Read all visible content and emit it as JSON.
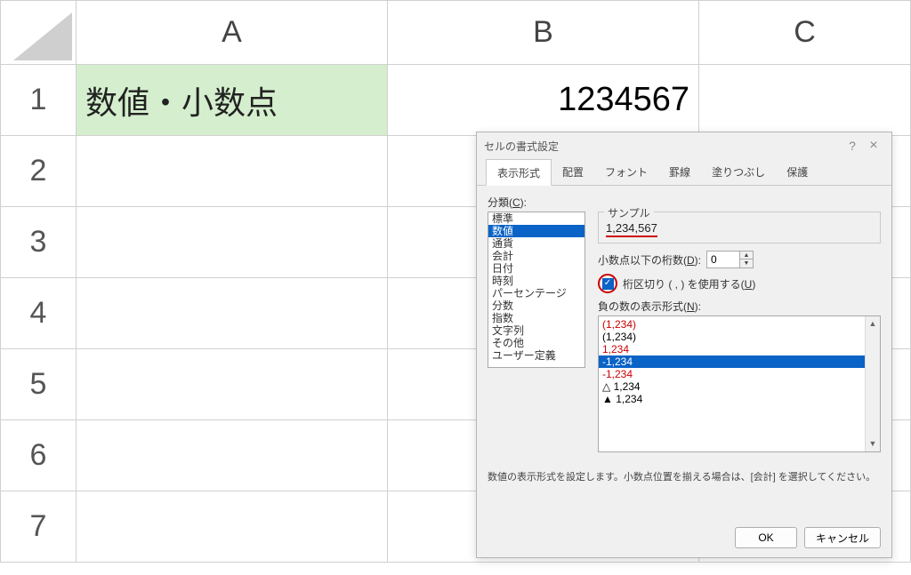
{
  "columns": [
    "A",
    "B",
    "C"
  ],
  "rows": [
    "1",
    "2",
    "3",
    "4",
    "5",
    "6",
    "7"
  ],
  "cells": {
    "a1": "数値・小数点",
    "b1": "1234567"
  },
  "dialog": {
    "title": "セルの書式設定",
    "tabs": [
      "表示形式",
      "配置",
      "フォント",
      "罫線",
      "塗りつぶし",
      "保護"
    ],
    "active_tab": 0,
    "category_label": "分類(",
    "category_label_key": "C",
    "categories": [
      "標準",
      "数値",
      "通貨",
      "会計",
      "日付",
      "時刻",
      "パーセンテージ",
      "分数",
      "指数",
      "文字列",
      "その他",
      "ユーザー定義"
    ],
    "selected_category_index": 1,
    "sample_label": "サンプル",
    "sample_value": "1,234,567",
    "decimal_label_pre": "小数点以下の桁数(",
    "decimal_label_key": "D",
    "decimal_value": "0",
    "thousands_label_pre": "桁区切り ( , ) を使用する(",
    "thousands_label_key": "U",
    "thousands_checked": true,
    "negative_label_pre": "負の数の表示形式(",
    "negative_label_key": "N",
    "negative_formats": [
      {
        "text": "(1,234)",
        "color": "red"
      },
      {
        "text": "(1,234)",
        "color": "black"
      },
      {
        "text": "1,234",
        "color": "red"
      },
      {
        "text": "-1,234",
        "color": "white",
        "selected": true
      },
      {
        "text": "-1,234",
        "color": "red"
      },
      {
        "text": "△ 1,234",
        "color": "black"
      },
      {
        "text": "▲ 1,234",
        "color": "black"
      }
    ],
    "help_text": "数値の表示形式を設定します。小数点位置を揃える場合は、[会計] を選択してください。",
    "ok_label": "OK",
    "cancel_label": "キャンセル"
  }
}
